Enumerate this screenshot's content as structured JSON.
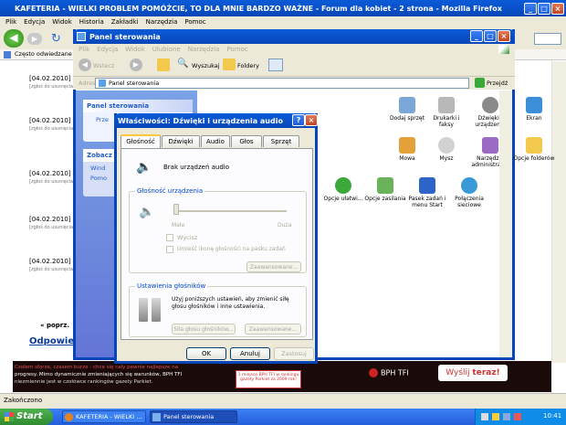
{
  "firefox": {
    "title": "KAFETERIA - WIELKI PROBLEM POMÓŻCIE, TO DLA MNIE BARDZO WAŻNE - Forum dla kobiet - 2 strona - Mozilla Firefox",
    "menu": [
      "Plik",
      "Edycja",
      "Widok",
      "Historia",
      "Zakładki",
      "Narzędzia",
      "Pomoc"
    ],
    "bookmark": "Często odwiedzane",
    "status": "Zakończono"
  },
  "forum": {
    "dates": [
      "[04.02.2010]",
      "[04.02.2010]",
      "[04.02.2010]",
      "[04.02.2010]",
      "[04.02.2010]"
    ],
    "sub": "[zgłoś do usunięcia]",
    "prev": "« poprz.",
    "reply": "Odpowiedz"
  },
  "ad": {
    "line1": "Czołem sforze, czasem burze - chce się cały pewnie najlepsze na",
    "line2": "progresy. Mimo dynamicznie zmieniających się warunków, BPH TFI",
    "line3": "niezmiennie jest w czołówce rankingów gazety Parkiet.",
    "stamp": "1 miejsce BPH TFI w rankingu gazety Parkiet za 2009 rok!",
    "brand": "BPH TFI",
    "cta_pre": "Wyślij ",
    "cta": "teraz!"
  },
  "cp": {
    "title": "Panel sterowania",
    "menu": [
      "Plik",
      "Edycja",
      "Widok",
      "Ulubione",
      "Narzędzia",
      "Pomoc"
    ],
    "back": "Wstecz",
    "search": "Wyszukaj",
    "folders": "Foldery",
    "addr_label": "Adres",
    "addr": "Panel sterowania",
    "go": "Przejdź",
    "side_title": "Panel sterowania",
    "side_switch": "Prze",
    "see_title": "Zobacz t",
    "see1": "Wind",
    "see2": "Pomo",
    "items": [
      "Dodaj sprzęt",
      "Drukarki i faksy",
      "Dźwięki i urządzen...",
      "Ekran",
      "Mowa",
      "Mysz",
      "Narzędzia administrac...",
      "Opcje folderów",
      "Opcje ułatwi...",
      "Opcje zasilania",
      "Pasek zadań i menu Start",
      "Połączenia sieciowe"
    ]
  },
  "dlg": {
    "title": "Właściwości: Dźwięki i urządzenia audio",
    "tabs": [
      "Głośność",
      "Dźwięki",
      "Audio",
      "Głos",
      "Sprzęt"
    ],
    "device": "Brak urządzeń audio",
    "vol_group": "Głośność urządzenia",
    "low": "Mała",
    "high": "Duża",
    "vol_level": 0.0,
    "mute": "Wycisz",
    "tray": "Umieść ikonę głośności na pasku zadań",
    "adv": "Zaawansowane...",
    "spk_group": "Ustawienia głośników",
    "spk_text": "Użyj poniższych ustawień, aby zmienić siłę głosu głośników i inne ustawienia.",
    "spk_vol": "Siła głosu głośników...",
    "adv2": "Zaawansowane...",
    "ok": "OK",
    "cancel": "Anuluj",
    "apply": "Zastosuj"
  },
  "taskbar": {
    "start": "Start",
    "task1": "KAFETERIA - WIELKI ...",
    "task2": "Panel sterowania",
    "clock": "10:41"
  }
}
